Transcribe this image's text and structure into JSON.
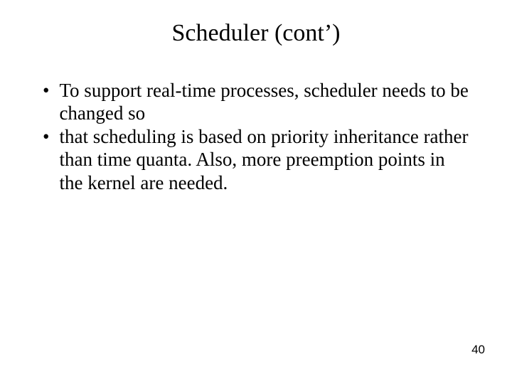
{
  "slide": {
    "title": "Scheduler (cont’)",
    "bullets": [
      "To support real-time processes, scheduler needs to be changed so",
      "that scheduling is based on priority inheritance rather than time quanta. Also, more preemption points in the kernel are needed."
    ],
    "page_number": "40"
  }
}
